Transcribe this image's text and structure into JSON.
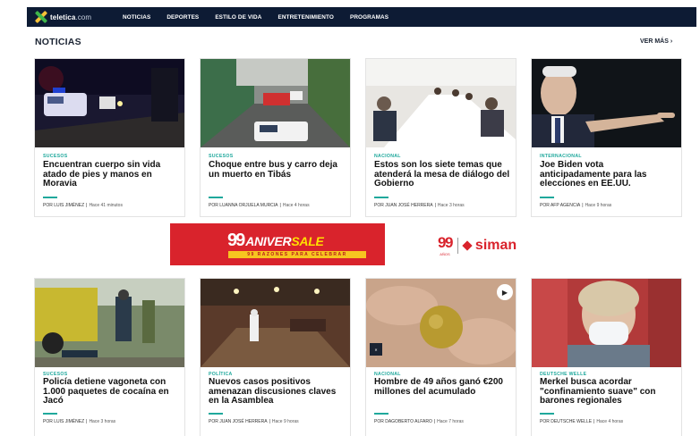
{
  "header": {
    "logo_name": "teletica",
    "logo_domain": ".com",
    "nav": [
      "NOTICIAS",
      "DEPORTES",
      "ESTILO DE VIDA",
      "ENTRETENIMIENTO",
      "PROGRAMAS"
    ]
  },
  "section": {
    "title": "NOTICIAS",
    "see_more": "VER MÁS  ›"
  },
  "articles": [
    {
      "category": "SUCESOS",
      "title": "Encuentran cuerpo sin vida atado de pies y manos en Moravia",
      "author": "POR LUIS JIMÉNEZ",
      "time": "Hace 41 minutos",
      "image_icon": "police-night-photo"
    },
    {
      "category": "SUCESOS",
      "title": "Choque entre bus y carro deja un muerto en Tibás",
      "author": "POR LUANNA ORJUELA MURCIA",
      "time": "Hace 4 horas",
      "image_icon": "street-crash-photo"
    },
    {
      "category": "NACIONAL",
      "title": "Estos son los siete temas que atenderá la mesa de diálogo del Gobierno",
      "author": "POR JUAN JOSÉ HERRERA",
      "time": "Hace 3 horas",
      "image_icon": "meeting-room-photo"
    },
    {
      "category": "INTERNACIONAL",
      "title": "Joe Biden vota anticipadamente para las elecciones en EE.UU.",
      "author": "POR AFP AGENCIA",
      "time": "Hace 9 horas",
      "image_icon": "biden-photo"
    },
    {
      "category": "SUCESOS",
      "title": "Policía detiene vagoneta con 1.000 paquetes de cocaína en Jacó",
      "author": "POR LUIS JIMÉNEZ",
      "time": "Hace 3 horas",
      "image_icon": "police-truck-photo"
    },
    {
      "category": "POLÍTICA",
      "title": "Nuevos casos positivos amenazan discusiones claves en la Asamblea",
      "author": "POR JUAN JOSÉ HERRERA",
      "time": "Hace 9 horas",
      "image_icon": "assembly-cleaning-photo"
    },
    {
      "category": "NACIONAL",
      "title": "Hombre de 49 años ganó €200 millones del acumulado",
      "author": "POR DAGOBERTO ALFARO",
      "time": "Hace 7 horas",
      "image_icon": "lottery-ball-photo"
    },
    {
      "category": "DEUTSCHE WELLE",
      "title": "Merkel busca acordar \"confinamiento suave\" con barones regionales",
      "author": "POR DEUTSCHE WELLE",
      "time": "Hace 4 horas",
      "image_icon": "merkel-mask-photo"
    }
  ],
  "ad": {
    "num": "99",
    "word1": "ANIVER",
    "word2": "SALE",
    "strip": "99 RAZONES PARA CELEBRAR",
    "brand_num": "99",
    "brand_sub": "AÑOS",
    "brand_name": "siman"
  },
  "colors": {
    "nav_bg": "#0d1b34",
    "accent": "#1fa89c",
    "ad_red": "#d9232c",
    "ad_yellow": "#ffe000"
  }
}
